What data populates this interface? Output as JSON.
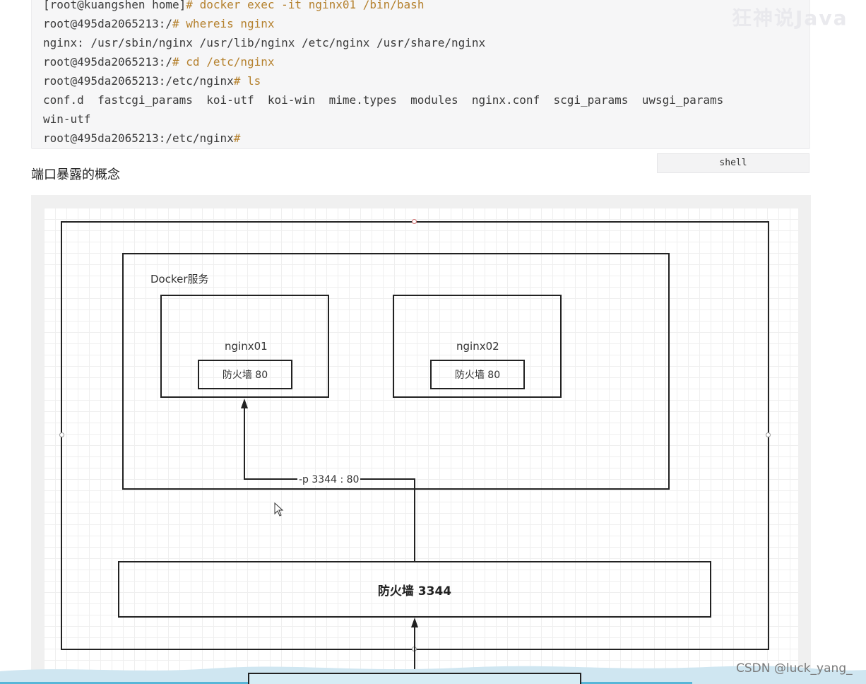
{
  "code_block": {
    "lines": [
      {
        "prompt": "[root@kuangshen home]",
        "command": "# docker exec -it nginx01 /bin/bash"
      },
      {
        "prompt": "root@495da2065213:/",
        "command": "# whereis nginx"
      },
      {
        "prompt": "nginx: /usr/sbin/nginx /usr/lib/nginx /etc/nginx /usr/share/nginx",
        "command": ""
      },
      {
        "prompt": "root@495da2065213:/",
        "command": "# cd /etc/nginx"
      },
      {
        "prompt": "root@495da2065213:/etc/nginx",
        "command": "# ls"
      },
      {
        "prompt": "conf.d  fastcgi_params  koi-utf  koi-win  mime.types  modules  nginx.conf  scgi_params  uwsgi_params",
        "command": ""
      },
      {
        "prompt": "win-utf",
        "command": ""
      },
      {
        "prompt": "root@495da2065213:/etc/nginx",
        "command": "#"
      }
    ],
    "language": "shell"
  },
  "heading": "端口暴露的概念",
  "diagram": {
    "docker_label": "Docker服务",
    "container1": {
      "name": "nginx01",
      "firewall": "防火墙  80"
    },
    "container2": {
      "name": "nginx02",
      "firewall": "防火墙  80"
    },
    "port_mapping": "-p 3344 : 80",
    "host_firewall": "防火墙   3344"
  },
  "watermarks": {
    "top_right": "狂神说Java",
    "bottom_right": "CSDN @luck_yang_"
  }
}
